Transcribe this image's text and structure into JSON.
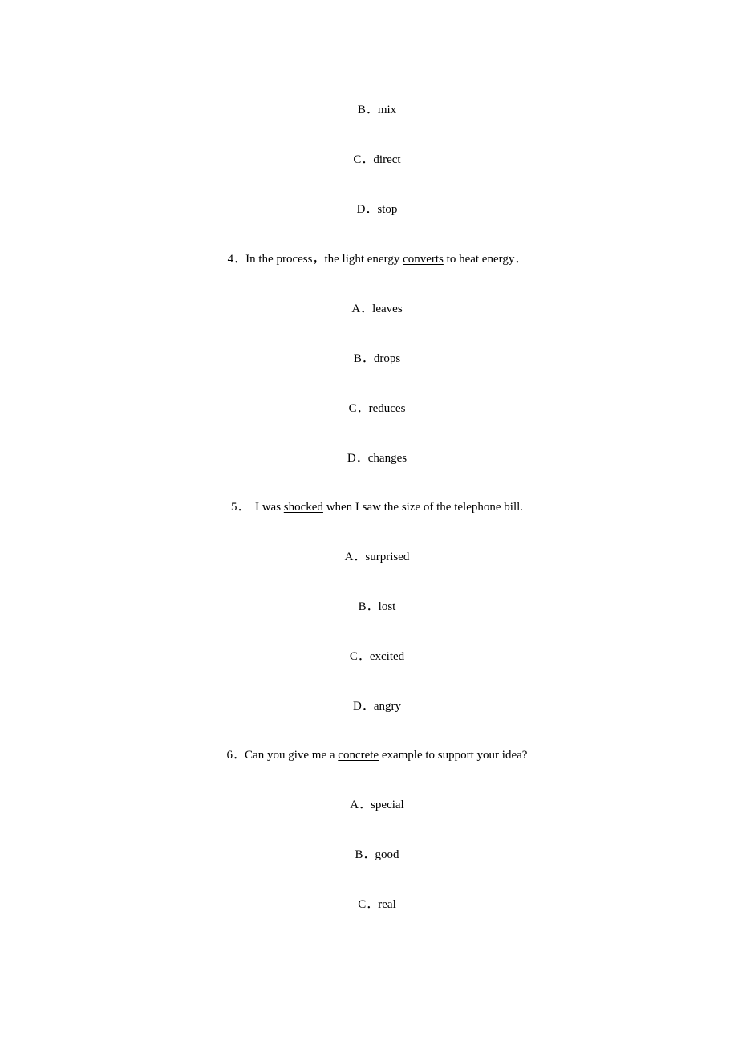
{
  "items": [
    {
      "type": "option",
      "text": "B．mix"
    },
    {
      "type": "option",
      "text": "C．direct"
    },
    {
      "type": "option",
      "text": "D．stop"
    },
    {
      "type": "question",
      "pre": "4．In the process，the light energy ",
      "underlined": "converts",
      "post": " to heat energy．"
    },
    {
      "type": "option",
      "text": "A．leaves"
    },
    {
      "type": "option",
      "text": "B．drops"
    },
    {
      "type": "option",
      "text": "C．reduces"
    },
    {
      "type": "option",
      "text": "D．changes"
    },
    {
      "type": "question",
      "pre": "5．  I was ",
      "underlined": "shocked",
      "post": " when I saw the size of the telephone bill."
    },
    {
      "type": "option",
      "text": "A．surprised"
    },
    {
      "type": "option",
      "text": "B．lost"
    },
    {
      "type": "option",
      "text": "C．excited"
    },
    {
      "type": "option",
      "text": "D．angry"
    },
    {
      "type": "question",
      "pre": "6．Can you give me a ",
      "underlined": "concrete",
      "post": " example to support your idea?"
    },
    {
      "type": "option",
      "text": "A．special"
    },
    {
      "type": "option",
      "text": "B．good"
    },
    {
      "type": "option",
      "text": "C．real"
    }
  ]
}
